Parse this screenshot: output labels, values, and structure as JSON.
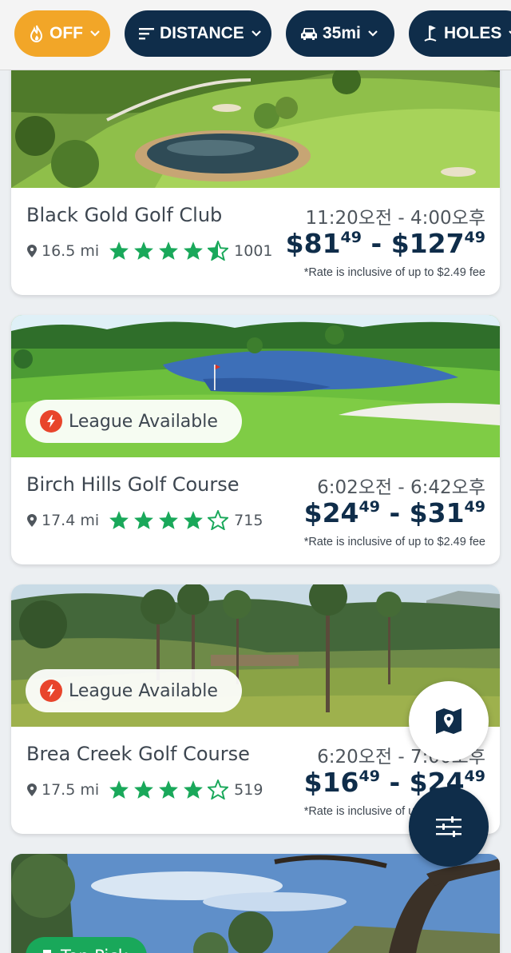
{
  "filters": {
    "hot_deals": {
      "label": "OFF",
      "icon": "flame-icon",
      "color": "#f2a628"
    },
    "sort": {
      "label": "DISTANCE",
      "icon": "sort-lines-icon"
    },
    "radius": {
      "label": "35mi",
      "icon": "car-icon"
    },
    "holes": {
      "label": "HOLES",
      "icon": "golf-flag-icon"
    },
    "chip_color": "#0f2d4a"
  },
  "courses": [
    {
      "name": "Black Gold Golf Club",
      "distance": "16.5 mi",
      "rating": 4.5,
      "reviews": "1001",
      "times": "11:20오전 - 4:00오후",
      "price_low": "$81",
      "price_low_cents": "49",
      "price_sep": " - ",
      "price_high": "$127",
      "price_high_cents": "49",
      "fee_note": "*Rate is inclusive of up to $2.49 fee"
    },
    {
      "name": "Birch Hills Golf Course",
      "distance": "17.4 mi",
      "rating": 4,
      "reviews": "715",
      "times": "6:02오전 - 6:42오후",
      "price_low": "$24",
      "price_low_cents": "49",
      "price_sep": " - ",
      "price_high": "$31",
      "price_high_cents": "49",
      "fee_note": "*Rate is inclusive of up to $2.49 fee",
      "badge": "League Available"
    },
    {
      "name": "Brea Creek Golf Course",
      "distance": "17.5 mi",
      "rating": 4,
      "reviews": "519",
      "times": "6:20오전 - 7:00오후",
      "price_low": "$16",
      "price_low_cents": "49",
      "price_sep": " - ",
      "price_high": "$24",
      "price_high_cents": "49",
      "fee_note": "*Rate is inclusive of up to $2.49 fee",
      "badge": "League Available"
    },
    {
      "badge": "Top Pick"
    }
  ],
  "colors": {
    "navy": "#0f2d4a",
    "star_green": "#19a85a",
    "league_red": "#e8452c"
  },
  "fabs": {
    "map": "map-pin-icon",
    "filter": "sliders-icon"
  }
}
